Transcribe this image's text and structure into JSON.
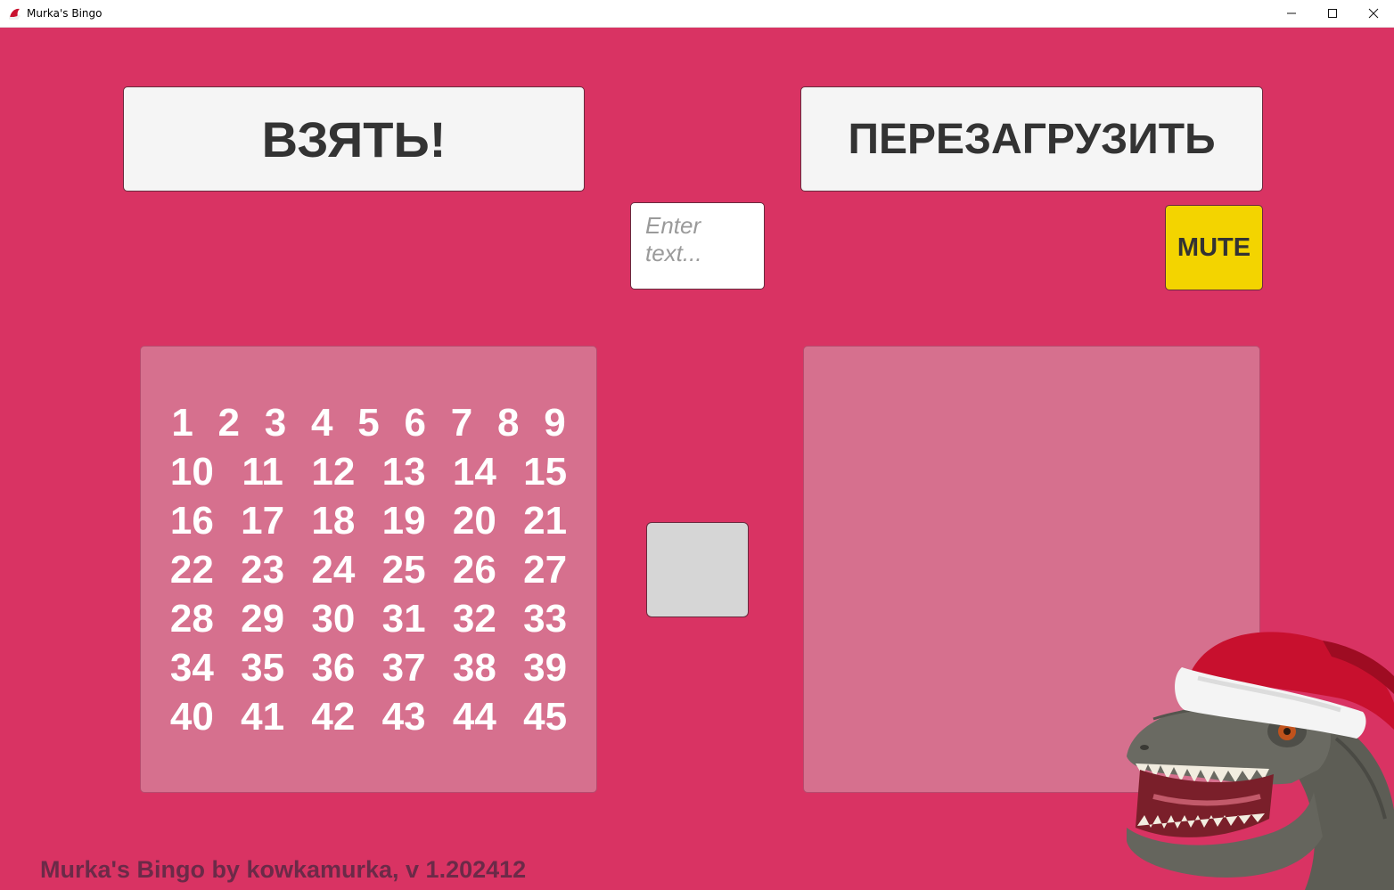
{
  "window": {
    "title": "Murka's Bingo",
    "icon": "santa-hat-icon",
    "controls": [
      "minimize-icon",
      "maximize-icon",
      "close-icon"
    ]
  },
  "colors": {
    "background": "#d93363",
    "panel": "#d6708e",
    "button": "#f5f5f5",
    "mute_button": "#f3d400",
    "footer_text": "#6b2a48"
  },
  "buttons": {
    "take_label": "ВЗЯТЬ!",
    "reload_label": "ПЕРЕЗАГРУЗИТЬ",
    "mute_label": "MUTE"
  },
  "input": {
    "placeholder": "Enter text...",
    "value": ""
  },
  "numbers": {
    "rows": [
      [
        "1",
        "2",
        "3",
        "4",
        "5",
        "6",
        "7",
        "8",
        "9"
      ],
      [
        "10",
        "11",
        "12",
        "13",
        "14",
        "15"
      ],
      [
        "16",
        "17",
        "18",
        "19",
        "20",
        "21"
      ],
      [
        "22",
        "23",
        "24",
        "25",
        "26",
        "27"
      ],
      [
        "28",
        "29",
        "30",
        "31",
        "32",
        "33"
      ],
      [
        "34",
        "35",
        "36",
        "37",
        "38",
        "39"
      ],
      [
        "40",
        "41",
        "42",
        "43",
        "44",
        "45"
      ]
    ]
  },
  "footer": {
    "text": "Murka's Bingo by kowkamurka, v 1.202412"
  },
  "mascot": "dinosaur-santa-hat-image"
}
